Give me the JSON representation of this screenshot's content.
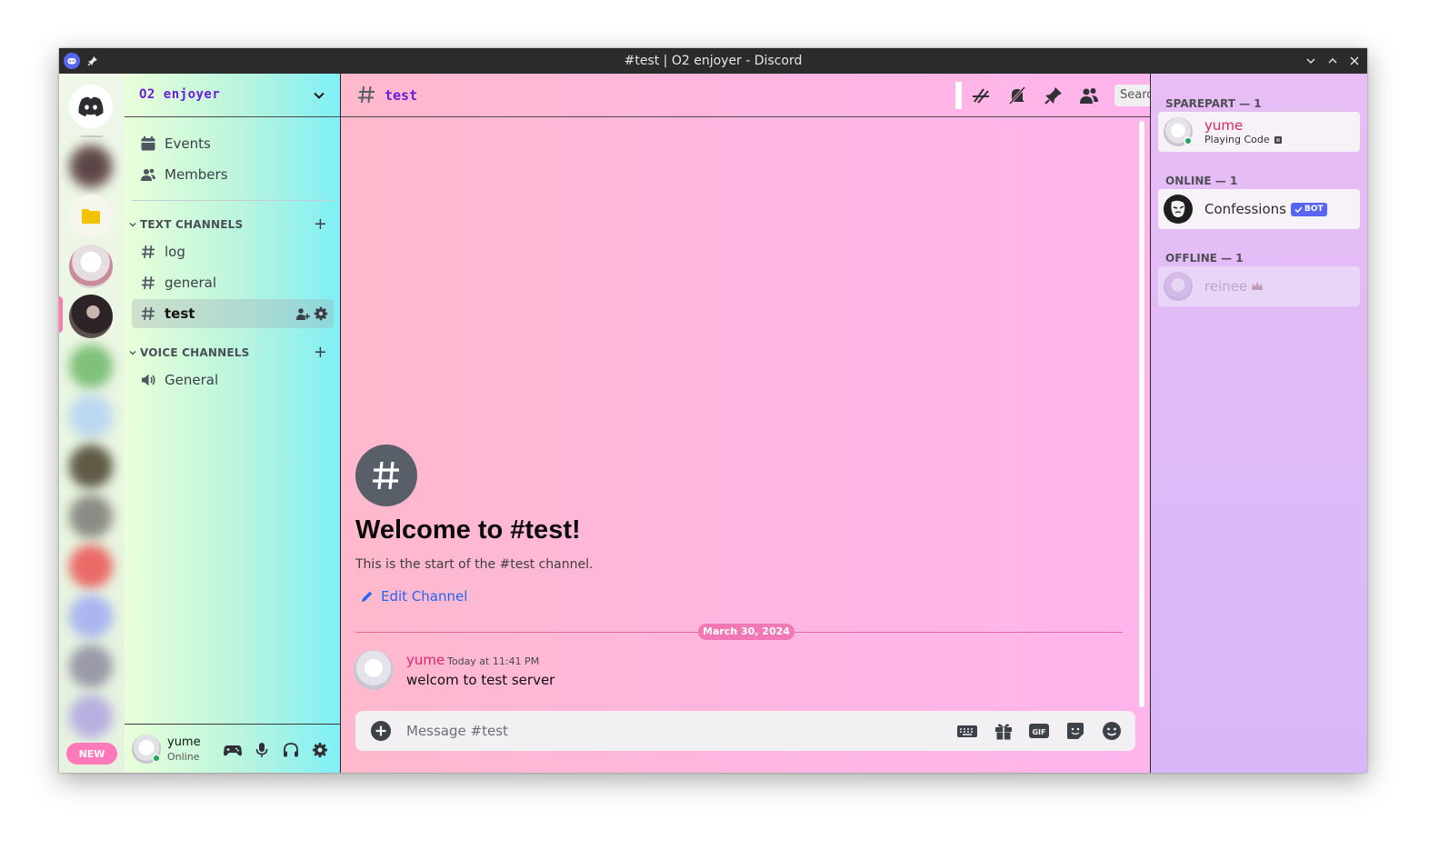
{
  "window": {
    "title": "#test | O2 enjoyer - Discord"
  },
  "rail": {
    "new_badge": "NEW"
  },
  "server": {
    "name": "O2 enjoyer",
    "quick_links": [
      {
        "label": "Events",
        "icon": "calendar-icon"
      },
      {
        "label": "Members",
        "icon": "members-icon"
      }
    ],
    "text_category": "TEXT CHANNELS",
    "text_channels": [
      {
        "label": "log"
      },
      {
        "label": "general"
      },
      {
        "label": "test",
        "active": true
      }
    ],
    "voice_category": "VOICE CHANNELS",
    "voice_channels": [
      {
        "label": "General"
      }
    ]
  },
  "user_panel": {
    "name": "yume",
    "status": "Online"
  },
  "channel": {
    "name": "test",
    "search_placeholder": "Search",
    "welcome_title": "Welcome to #test!",
    "welcome_subtitle": "This is the start of the #test channel.",
    "edit_label": "Edit Channel",
    "date_divider": "March 30, 2024",
    "message": {
      "author": "yume",
      "time": "Today at 11:41 PM",
      "text": "welcom to test server"
    },
    "composer_placeholder": "Message #test"
  },
  "members": {
    "groups": [
      {
        "header": "SPAREPART — 1",
        "name": "yume",
        "activity": "Playing Code"
      },
      {
        "header": "ONLINE — 1",
        "name": "Confessions",
        "tag": "BOT"
      },
      {
        "header": "OFFLINE — 1",
        "name": "reinee"
      }
    ]
  },
  "colors": {
    "brand": "#5865f2",
    "author": "#e4226a",
    "link": "#1e66f5",
    "accent": "#6b1cd6",
    "online": "#23a55a"
  }
}
